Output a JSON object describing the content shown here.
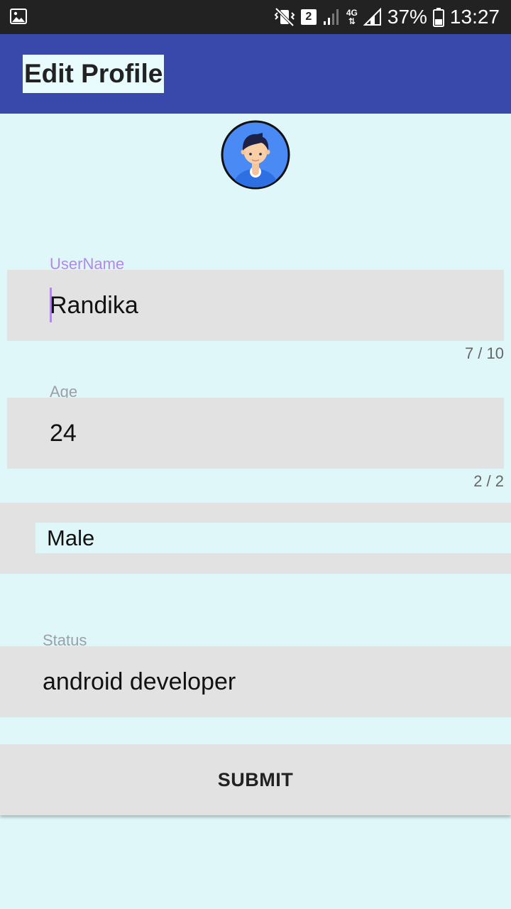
{
  "status_bar": {
    "sim_slot": "2",
    "network_type": "4G",
    "battery": "37%",
    "time": "13:27",
    "icons": [
      "gallery-icon",
      "mute-vibrate-icon",
      "sim-icon",
      "signal-icon",
      "network-4g-icon",
      "signal-icon",
      "battery-icon"
    ]
  },
  "app_bar": {
    "title": "Edit Profile",
    "color": "#3949ab"
  },
  "avatar": {
    "icon": "user-avatar-icon"
  },
  "form": {
    "username": {
      "label": "UserName",
      "value": "Randika",
      "counter": "7 / 10"
    },
    "age": {
      "label": "Age",
      "value": "24",
      "counter": "2 / 2"
    },
    "gender": {
      "selected": "Male"
    },
    "status": {
      "label": "Status",
      "value": "android developer"
    }
  },
  "submit": {
    "label": "SUBMIT"
  },
  "colors": {
    "background": "#e0f7f9",
    "field": "#e2e2e2",
    "accent": "#b388e8"
  }
}
